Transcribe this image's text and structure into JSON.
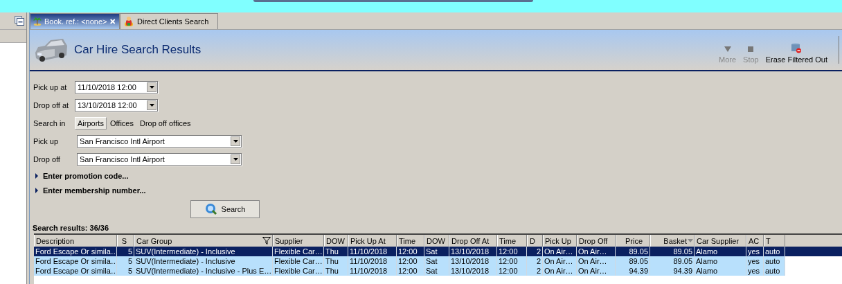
{
  "tabs": [
    {
      "label": "Book. ref.: <none>",
      "selected": true,
      "closable": true,
      "kind": "palm"
    },
    {
      "label": "Direct Clients Search",
      "selected": false,
      "closable": false,
      "kind": "person"
    }
  ],
  "header": {
    "title": "Car Hire Search Results"
  },
  "toolbar": [
    {
      "label": "More",
      "disabled": true,
      "kind": "more"
    },
    {
      "label": "Stop",
      "disabled": true,
      "kind": "stop"
    },
    {
      "label": "Erase Filtered Out",
      "disabled": false,
      "kind": "erase"
    }
  ],
  "form": {
    "pick_up_at": {
      "label": "Pick up at",
      "value": "11/10/2018 12:00"
    },
    "drop_off_at": {
      "label": "Drop off at",
      "value": "13/10/2018 12:00"
    },
    "search_in": {
      "label": "Search in",
      "options": [
        {
          "label": "Airports",
          "selected": true
        },
        {
          "label": "Offices",
          "selected": false
        },
        {
          "label": "Drop off offices",
          "selected": false
        }
      ]
    },
    "pick_up": {
      "label": "Pick up",
      "value": "San Francisco Intl Airport"
    },
    "drop_off": {
      "label": "Drop off",
      "value": "San Francisco Intl Airport"
    },
    "expanders": [
      {
        "label": "Enter promotion code...",
        "expanded": false
      },
      {
        "label": "Enter membership number...",
        "expanded": false
      }
    ],
    "search_button": "Search"
  },
  "results": {
    "label": "Search results: 36/36",
    "columns": [
      {
        "label": "Description",
        "filtered": false,
        "sorted": false
      },
      {
        "label": "S",
        "filtered": false,
        "sorted": false
      },
      {
        "label": "Car Group",
        "filtered": true,
        "sorted": false
      },
      {
        "label": "Supplier",
        "filtered": false,
        "sorted": false
      },
      {
        "label": "DOW",
        "filtered": false,
        "sorted": false
      },
      {
        "label": "Pick Up At",
        "filtered": false,
        "sorted": false
      },
      {
        "label": "Time",
        "filtered": false,
        "sorted": false
      },
      {
        "label": "DOW",
        "filtered": false,
        "sorted": false
      },
      {
        "label": "Drop Off At",
        "filtered": false,
        "sorted": false
      },
      {
        "label": "Time",
        "filtered": false,
        "sorted": false
      },
      {
        "label": "D",
        "filtered": false,
        "sorted": false
      },
      {
        "label": "Pick Up",
        "filtered": false,
        "sorted": false
      },
      {
        "label": "Drop Off",
        "filtered": false,
        "sorted": false
      },
      {
        "label": "Price",
        "filtered": false,
        "sorted": false
      },
      {
        "label": "Basket",
        "filtered": false,
        "sorted": true
      },
      {
        "label": "Car Supplier",
        "filtered": false,
        "sorted": false
      },
      {
        "label": "AC",
        "filtered": false,
        "sorted": false
      },
      {
        "label": "T",
        "filtered": false,
        "sorted": false
      }
    ],
    "rows": [
      {
        "selected": true,
        "cells": [
          "Ford Escape Or simila…",
          "5",
          "SUV(Intermediate) - Inclusive",
          "Flexible Car…",
          "Thu",
          "11/10/2018",
          "12:00",
          "Sat",
          "13/10/2018",
          "12:00",
          "2",
          "On Air…",
          "On Air…",
          "89.05",
          "89.05",
          "Alamo",
          "yes",
          "auto"
        ]
      },
      {
        "selected": false,
        "cells": [
          "Ford Escape Or simila…",
          "5",
          "SUV(Intermediate) - Inclusive",
          "Flexible Car…",
          "Thu",
          "11/10/2018",
          "12:00",
          "Sat",
          "13/10/2018",
          "12:00",
          "2",
          "On Air…",
          "On Air…",
          "89.05",
          "89.05",
          "Alamo",
          "yes",
          "auto"
        ]
      },
      {
        "selected": false,
        "cells": [
          "Ford Escape Or simila…",
          "5",
          "SUV(Intermediate) - Inclusive - Plus E…",
          "Flexible Car…",
          "Thu",
          "11/10/2018",
          "12:00",
          "Sat",
          "13/10/2018",
          "12:00",
          "2",
          "On Air…",
          "On Air…",
          "94.39",
          "94.39",
          "Alamo",
          "yes",
          "auto"
        ]
      }
    ]
  }
}
